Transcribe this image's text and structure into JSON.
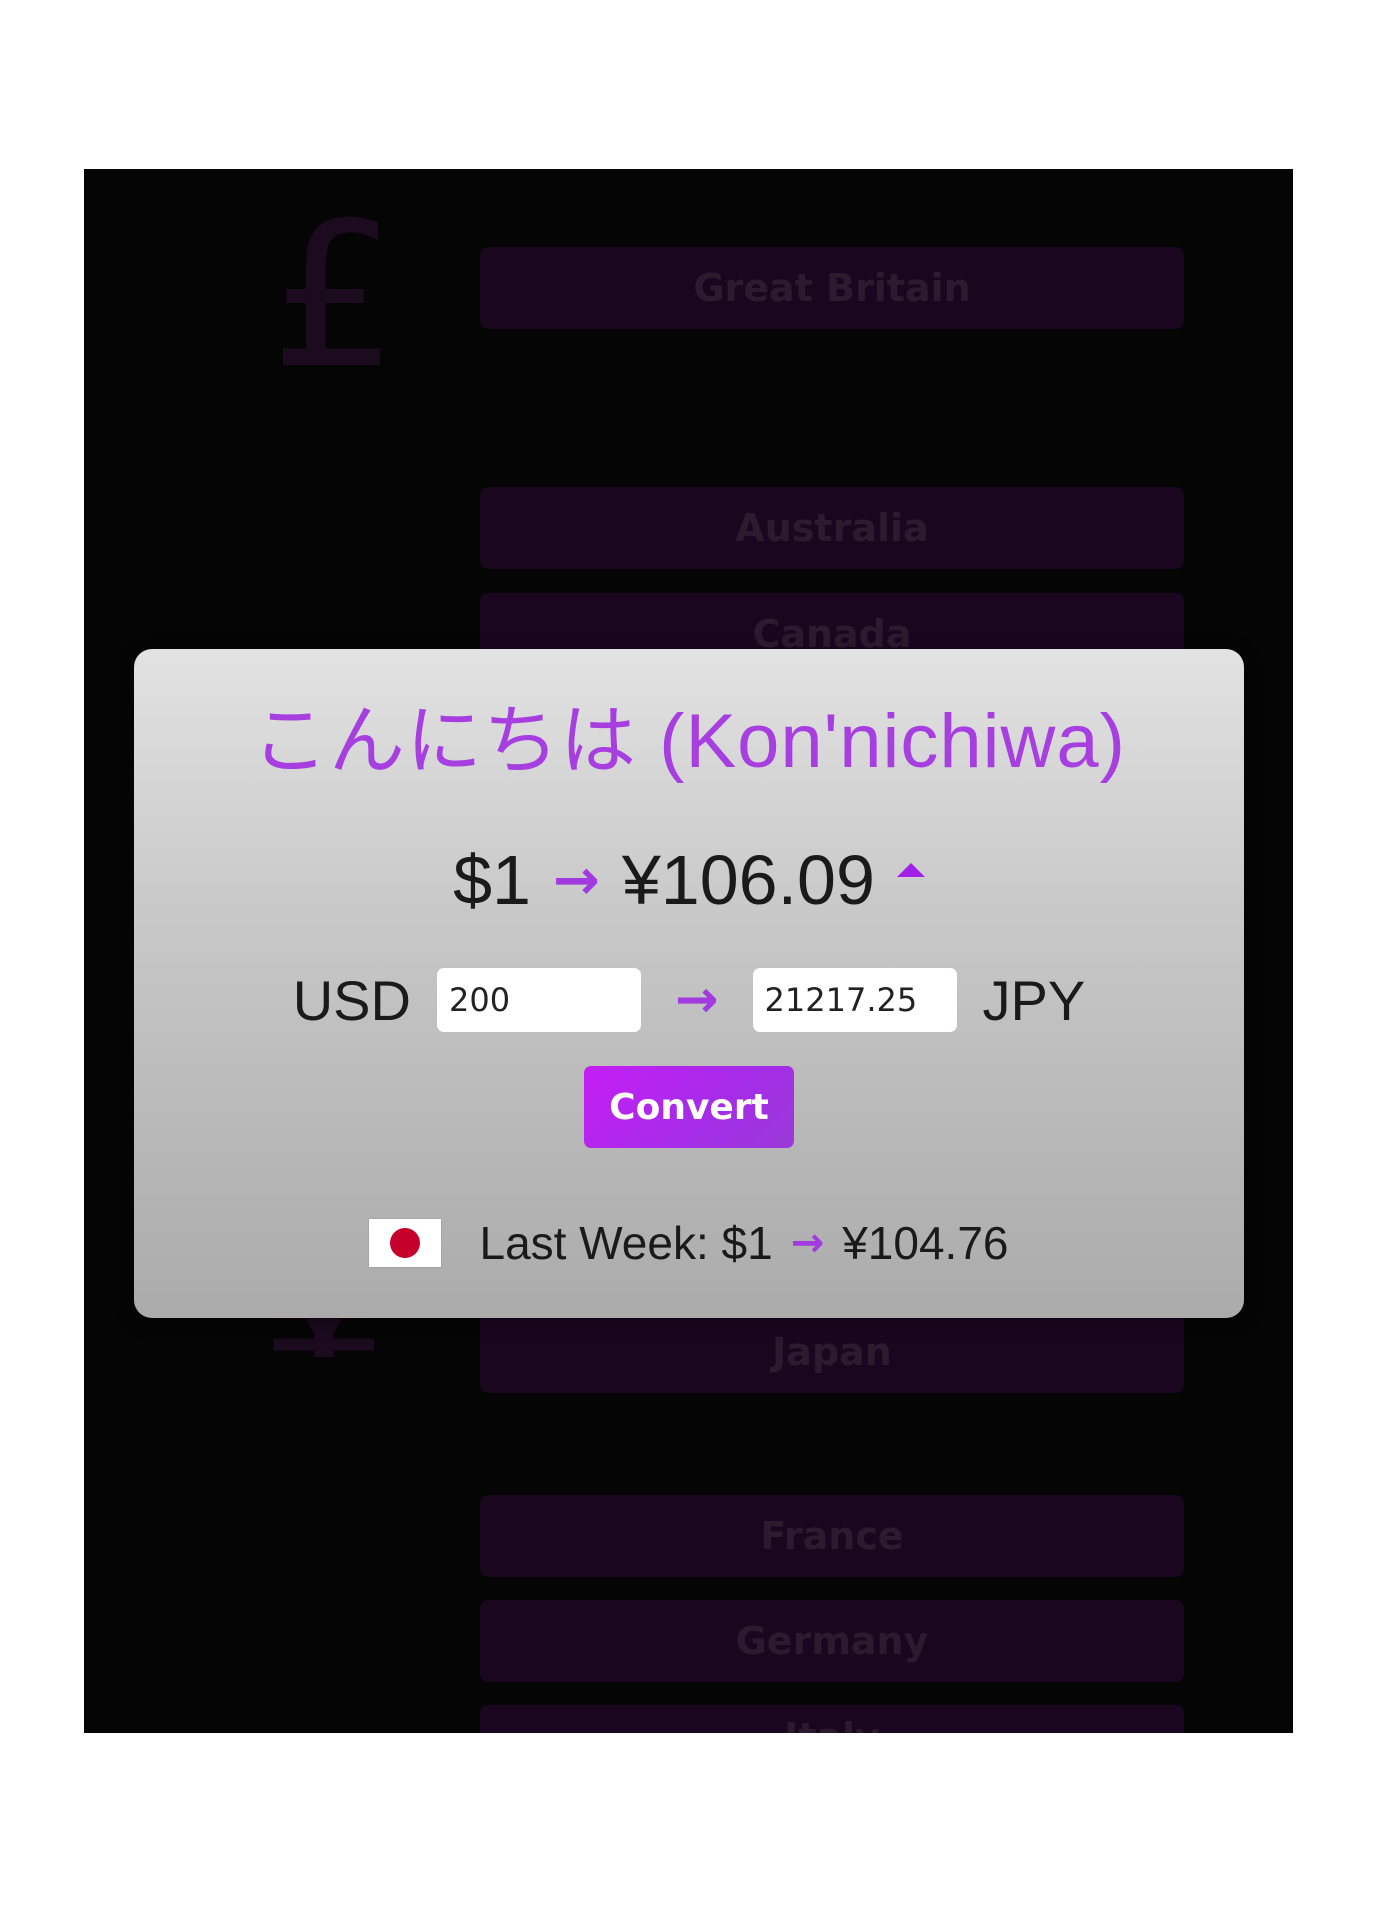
{
  "background": {
    "symbols": {
      "pound": "£",
      "yen": "¥"
    },
    "countries": [
      "Great Britain",
      "Australia",
      "Canada",
      "Japan",
      "France",
      "Germany",
      "Italy"
    ]
  },
  "modal": {
    "greeting": "こんにちは (Kon'nichiwa)",
    "rate": {
      "from": "$1",
      "to": "¥106.09",
      "trend": "up"
    },
    "converter": {
      "from_code": "USD",
      "from_value": "200",
      "to_value": "21217.25",
      "to_code": "JPY"
    },
    "convert_label": "Convert",
    "last_week": {
      "label": "Last Week: $1",
      "to": "¥104.76",
      "flag_icon": "japan-flag-icon"
    }
  },
  "colors": {
    "accent": "#a63ee0",
    "button": "#c51ef5",
    "background": "#050505",
    "modal": "#d0d0d0"
  }
}
